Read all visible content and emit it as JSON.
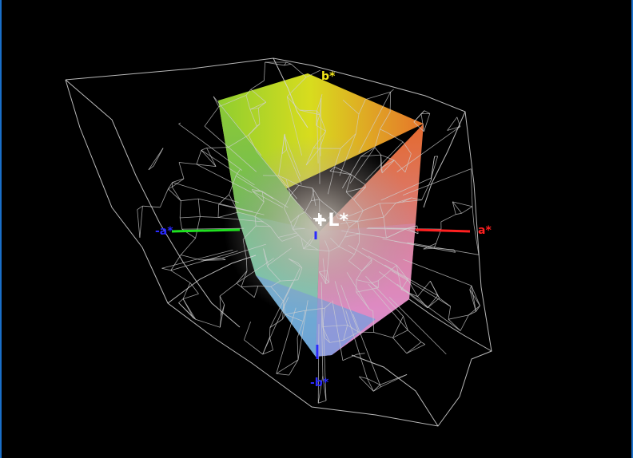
{
  "axes": {
    "plus_b": "b*",
    "minus_b": "-b*",
    "plus_a": "a*",
    "minus_a": "-a*",
    "l_star": "+L*"
  },
  "colors": {
    "background": "#000000",
    "frame": "#1a6fc8",
    "wireframe": "#d8d8d8",
    "a_axis": "#ff2020",
    "minus_a_axis": "#20e020",
    "b_axis": "#f2e61a",
    "minus_b_axis": "#2a2aff",
    "l_axis": "#ffffff"
  }
}
